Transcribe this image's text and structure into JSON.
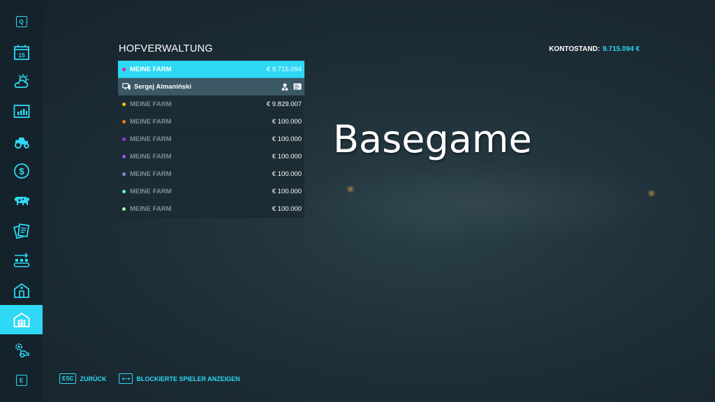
{
  "header": {
    "title": "HOFVERWALTUNG",
    "balance_label": "KONTOSTAND:",
    "balance_value": "9.715.094 €"
  },
  "sidebar": {
    "top_key": "Q",
    "bottom_key": "E",
    "calendar_day": "15",
    "items": [
      {
        "icon": "calendar-icon"
      },
      {
        "icon": "weather-icon"
      },
      {
        "icon": "statistics-icon"
      },
      {
        "icon": "vehicles-icon"
      },
      {
        "icon": "finances-icon"
      },
      {
        "icon": "animals-icon"
      },
      {
        "icon": "contracts-icon"
      },
      {
        "icon": "production-icon"
      },
      {
        "icon": "farm-building-icon"
      },
      {
        "icon": "farm-management-icon",
        "active": true
      },
      {
        "icon": "settings-icon"
      }
    ],
    "accent_color": "#2fd8f5"
  },
  "farms": [
    {
      "name": "MEINE FARM",
      "money": "€ 9.715.094",
      "color": "#e0208c",
      "selected": true
    },
    {
      "player": "Sergej Almaniński"
    },
    {
      "name": "MEINE FARM",
      "money": "€ 9.829.007",
      "color": "#f5c300"
    },
    {
      "name": "MEINE FARM",
      "money": "€ 100.000",
      "color": "#f07a10"
    },
    {
      "name": "MEINE FARM",
      "money": "€ 100.000",
      "color": "#9b30d9"
    },
    {
      "name": "MEINE FARM",
      "money": "€ 100.000",
      "color": "#9a5cf0"
    },
    {
      "name": "MEINE FARM",
      "money": "€ 100.000",
      "color": "#6f8ff5"
    },
    {
      "name": "MEINE FARM",
      "money": "€ 100.000",
      "color": "#5ff0f0"
    },
    {
      "name": "MEINE FARM",
      "money": "€ 100.000",
      "color": "#a8f59a"
    }
  ],
  "watermark": "Basegame",
  "footer": {
    "back_key": "ESC",
    "back_label": "ZURÜCK",
    "blocked_key": "⟷",
    "blocked_label": "BLOCKIERTE SPIELER ANZEIGEN"
  }
}
